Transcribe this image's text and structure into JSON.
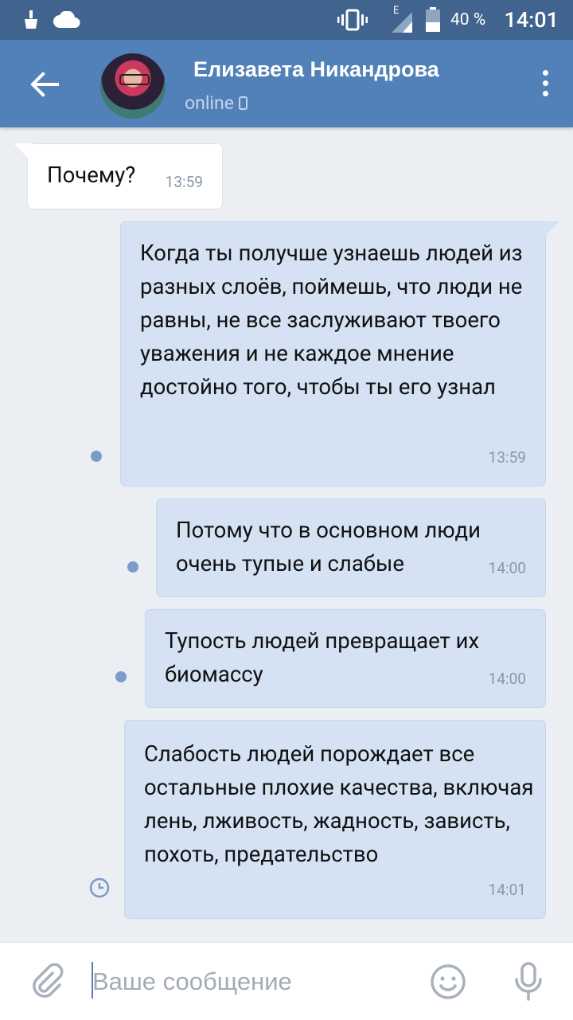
{
  "status_bar": {
    "network_label": "E",
    "battery_percent": "40 %",
    "time": "14:01"
  },
  "header": {
    "contact_name": "Елизавета Никандрова",
    "status": "online",
    "status_device_icon": "phone-icon"
  },
  "messages": [
    {
      "direction": "incoming",
      "text": "Почему?",
      "time": "13:59"
    },
    {
      "direction": "outgoing",
      "text": "Когда ты получше узнаешь людей из разных слоёв, поймешь, что люди не равны, не все заслуживают твоего уважения и не каждое мнение достойно того, чтобы ты его узнал",
      "time": "13:59",
      "state": "unread"
    },
    {
      "direction": "outgoing",
      "text": "Потому что в основном люди очень тупые и слабые",
      "time": "14:00",
      "state": "unread"
    },
    {
      "direction": "outgoing",
      "text": "Тупость людей превращает их биомассу",
      "time": "14:00",
      "state": "unread"
    },
    {
      "direction": "outgoing",
      "text": "Слабость людей порождает все остальные плохие качества, включая лень, лживость, жадность, зависть, похоть, предательство",
      "time": "14:01",
      "state": "sending"
    }
  ],
  "composer": {
    "placeholder": "Ваше сообщение",
    "value": ""
  },
  "icons": {
    "back": "arrow-left-icon",
    "menu": "more-vertical-icon",
    "attach": "paperclip-icon",
    "emoji": "smile-icon",
    "mic": "microphone-icon"
  },
  "colors": {
    "header": "#5181b8",
    "status_bar": "#41648f",
    "incoming_bubble": "#ffffff",
    "outgoing_bubble": "#d4e2f4",
    "background": "#ebeef2",
    "unread_dot": "#7a9cc6"
  }
}
